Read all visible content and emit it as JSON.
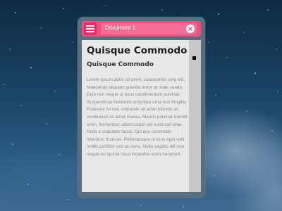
{
  "window": {
    "title": "Document 1"
  },
  "document": {
    "heading": "Quisque Commodo",
    "subheading": "Quisque Commodo",
    "body": "Lorem ipsum dolor sit amet, consectetur sing elit. Maecenas aliquam gravida tortor at male suada. Duis non neque ut risus condimentum pulvinar. Suspendisse hendrerit vulputate urna non fringilla. Praesent mi nisl, vulputate sit amet lobortis ac, vestibulum sit amet massa. Mauris pulvinar blandit enim, fermentum ullamcorper est euismod vitae. Nulla a vulputate lacus. Qui que commodo interdum rhoncus. Pellentesque ut eros eget velit mollis porttitor sed ac nunc. Nulla sagittis elit non neque eu lacinia risus imperdiet enim hendrerit ."
  },
  "icons": {
    "menu": "hamburger-menu-icon",
    "close": "close-icon"
  },
  "colors": {
    "titlebar": "#f04f80",
    "menu_button": "#d5346a",
    "window_frame": "#5b6e80",
    "document_bg": "#e8e8e8"
  }
}
